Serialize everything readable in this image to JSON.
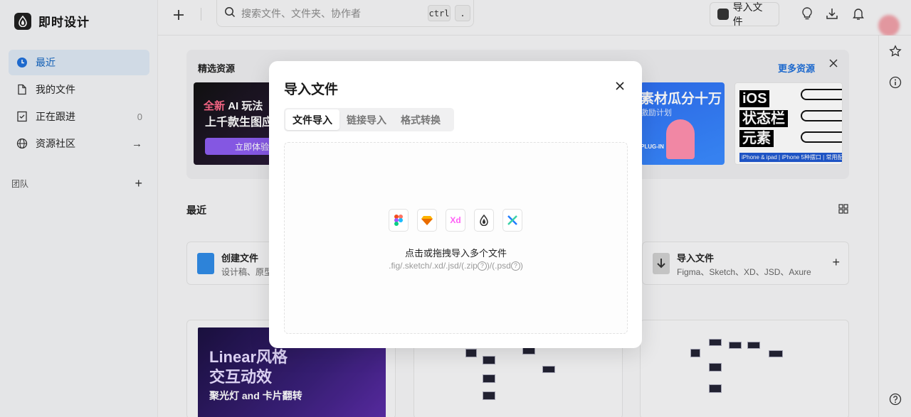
{
  "app": {
    "name": "即时设计"
  },
  "sidebar": {
    "items": [
      {
        "label": "最近",
        "icon": "clock-icon",
        "active": true,
        "trail": ""
      },
      {
        "label": "我的文件",
        "icon": "file-icon",
        "active": false,
        "trail": ""
      },
      {
        "label": "正在跟进",
        "icon": "follow-icon",
        "active": false,
        "trail": "0"
      },
      {
        "label": "资源社区",
        "icon": "globe-icon",
        "active": false,
        "trail": "→"
      }
    ],
    "team_label": "团队",
    "team_add": "+"
  },
  "topbar": {
    "search_placeholder": "搜索文件、文件夹、协作者",
    "kbd_ctrl": "ctrl",
    "kbd_dot": ".",
    "import_label": "导入文件"
  },
  "featured": {
    "title": "精选资源",
    "more": "更多资源",
    "banner1": {
      "new": "全新",
      "line1": "AI 玩法",
      "line2": "上千款生图应",
      "button": "立即体验"
    },
    "banner2": {
      "line1": "素材瓜分十万",
      "line2": "激励计划",
      "tag": "PLUG-IN"
    },
    "banner3": {
      "tag1": "iOS",
      "tag2": "状态栏",
      "tag3": "元素",
      "foot": "iPhone & ipad | iPhone 5种摆口 | 常用配置"
    }
  },
  "recent": {
    "title": "最近",
    "create": {
      "title": "创建文件",
      "sub": "设计稿、原型"
    },
    "import": {
      "title": "导入文件",
      "sub": "Figma、Sketch、XD、JSD、Axure",
      "add": "+"
    },
    "thumb1": {
      "line1": "Linear风格",
      "line2": "交互动效",
      "line3": "聚光灯 and 卡片翻转"
    }
  },
  "modal": {
    "title": "导入文件",
    "tabs": [
      "文件导入",
      "链接导入",
      "格式转换"
    ],
    "active_tab": 0,
    "format_icons": [
      "figma-icon",
      "sketch-icon",
      "xd-icon",
      "jsd-icon",
      "axure-icon"
    ],
    "xd_text": "Xd",
    "drop_main": "点击或拖拽导入多个文件",
    "drop_formats": ".fig/.sketch/.xd/.jsd/(.zip",
    "drop_mid": ")/(.psd",
    "drop_end": ")",
    "qmark": "?"
  },
  "colors": {
    "accent": "#1e6fd9",
    "active_bg": "#dce7f3"
  }
}
